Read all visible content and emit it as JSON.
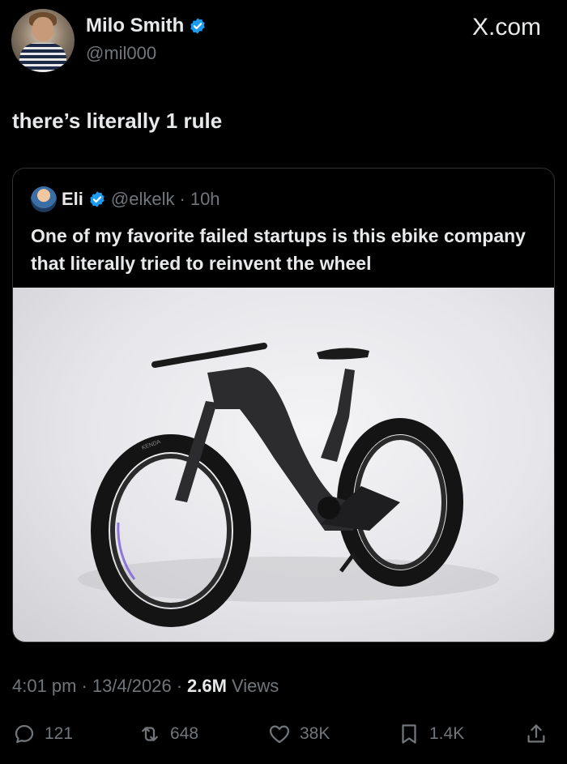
{
  "author": {
    "name": "Milo Smith",
    "handle": "@mil000",
    "verified": true
  },
  "site_label": "X.com",
  "tweet_text": "there’s literally 1 rule",
  "quote": {
    "name": "Eli",
    "handle": "@elkelk",
    "separator": "·",
    "time": "10h",
    "text": "One of my favorite failed startups is this ebike company that literally tried to reinvent the wheel",
    "image_alt": "Black hubless e-bike with hollow spokeless wheels on white studio background",
    "tire_text": "KENDA"
  },
  "meta": {
    "time": "4:01 pm",
    "sep1": "·",
    "date": "13/4/2026",
    "sep2": "·",
    "views_count": "2.6M",
    "views_label": "Views"
  },
  "actions": {
    "replies": "121",
    "reposts": "648",
    "likes": "38K",
    "bookmarks": "1.4K"
  },
  "colors": {
    "background": "#000000",
    "text": "#e7e9ea",
    "muted": "#71767b",
    "verified": "#1d9bf0",
    "border": "#2f3336"
  }
}
